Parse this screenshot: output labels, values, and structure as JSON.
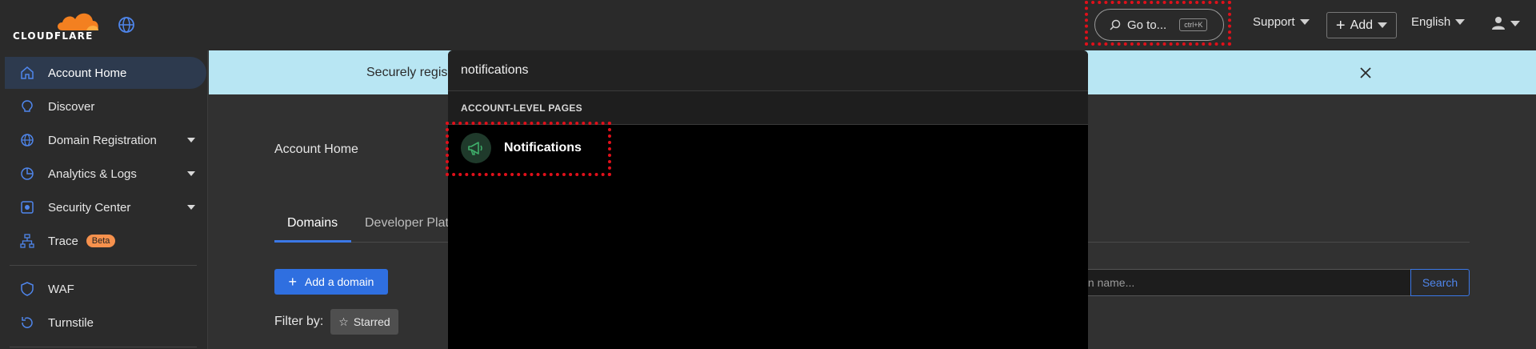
{
  "brand": {
    "wordmark": "CLOUDFLARE",
    "cloud_color": "#f38020"
  },
  "header": {
    "goto_label": "Go to...",
    "goto_shortcut": "ctrl+K",
    "support_label": "Support",
    "add_label": "Add",
    "language_label": "English"
  },
  "sidebar": {
    "items": [
      {
        "label": "Account Home",
        "icon": "home-icon"
      },
      {
        "label": "Discover",
        "icon": "lightbulb-icon"
      },
      {
        "label": "Domain Registration",
        "icon": "globe-icon"
      },
      {
        "label": "Analytics & Logs",
        "icon": "pie-chart-icon"
      },
      {
        "label": "Security Center",
        "icon": "security-center-icon"
      },
      {
        "label": "Trace",
        "icon": "trace-icon",
        "badge": "Beta"
      },
      {
        "label": "WAF",
        "icon": "shield-icon"
      },
      {
        "label": "Turnstile",
        "icon": "turnstile-icon"
      }
    ]
  },
  "banner": {
    "text_visible": "Securely regis",
    "bg_color": "#b8e6f3"
  },
  "main": {
    "title": "Account Home",
    "tabs": [
      {
        "label": "Domains"
      },
      {
        "label": "Developer Plat"
      }
    ],
    "add_domain_label": "Add a domain",
    "filter_label": "Filter by:",
    "starred_label": "Starred",
    "search_placeholder": "ain name...",
    "search_button": "Search"
  },
  "palette": {
    "query": "notifications",
    "group_heading": "ACCOUNT-LEVEL PAGES",
    "results": [
      {
        "label": "Notifications",
        "icon": "megaphone-icon"
      }
    ]
  },
  "colors": {
    "accent": "#2f6fe0",
    "highlight": "#e0101a"
  }
}
